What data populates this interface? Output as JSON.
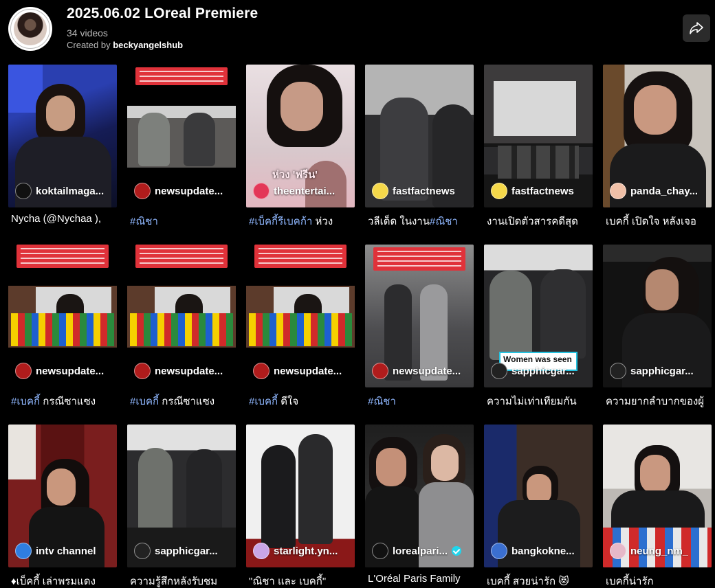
{
  "header": {
    "title": "2025.06.02 LOreal Premiere",
    "video_count": "34 videos",
    "created_by_label": "Created by",
    "creator": "beckyangelshub"
  },
  "icons": {
    "share": "share-arrow-icon",
    "verified": "verified-badge-icon"
  },
  "colors": {
    "background": "#000000",
    "hashtag": "#8fb7ff",
    "verified": "#20d5ec",
    "share_button": "#2b2b2b"
  },
  "videos": [
    {
      "author": "koktailmaga...",
      "caption": "Nycha (@Nychaa ),",
      "tag": ""
    },
    {
      "author": "newsupdate...",
      "caption": "",
      "tag": "#ณิชา"
    },
    {
      "author": "theentertai...",
      "caption": " ห่วง",
      "tag": "#เบ็คกี้รีเบคก้า",
      "overlay": "ห่วง 'ฟรีน'"
    },
    {
      "author": "fastfactnews",
      "caption": "วลีเด็ด  ในงาน",
      "tag": "#ณิชา"
    },
    {
      "author": "fastfactnews",
      "caption": "งานเปิดตัวสารคดีสุด",
      "tag": ""
    },
    {
      "author": "panda_chay...",
      "caption": "เบคกี้ เปิดใจ หลังเจอ",
      "tag": ""
    },
    {
      "author": "newsupdate...",
      "caption": " กรณีซาแซง",
      "tag": "#เบคกี้"
    },
    {
      "author": "newsupdate...",
      "caption": " กรณีซาแซง",
      "tag": "#เบคกี้"
    },
    {
      "author": "newsupdate...",
      "caption": " ดีใจ",
      "tag": "#เบคกี้"
    },
    {
      "author": "newsupdate...",
      "caption": "",
      "tag": "#ณิชา"
    },
    {
      "author": "sapphicgar...",
      "caption": "ความไม่เท่าเทียมกัน",
      "tag": "",
      "overlay": "Women was seen"
    },
    {
      "author": "sapphicgar...",
      "caption": "ความยากลำบากของผู้",
      "tag": ""
    },
    {
      "author": "intv channel",
      "caption": "♦เบ็คกี้ เล่าพรมแดง",
      "tag": ""
    },
    {
      "author": "sapphicgar...",
      "caption": "ความรู้สึกหลังรับชม",
      "tag": ""
    },
    {
      "author": "starlight.yn...",
      "caption": "\"ณิชา และ เบคกี้\"",
      "tag": ""
    },
    {
      "author": "lorealpari...",
      "caption": "L'Oréal Paris Family",
      "tag": "",
      "verified": true
    },
    {
      "author": "bangkokne...",
      "caption": "เบคกี้ สวยน่ารัก 😻",
      "tag": ""
    },
    {
      "author": "neung_nm_",
      "caption": "เบคกี้น่ารัก",
      "tag": ""
    }
  ]
}
